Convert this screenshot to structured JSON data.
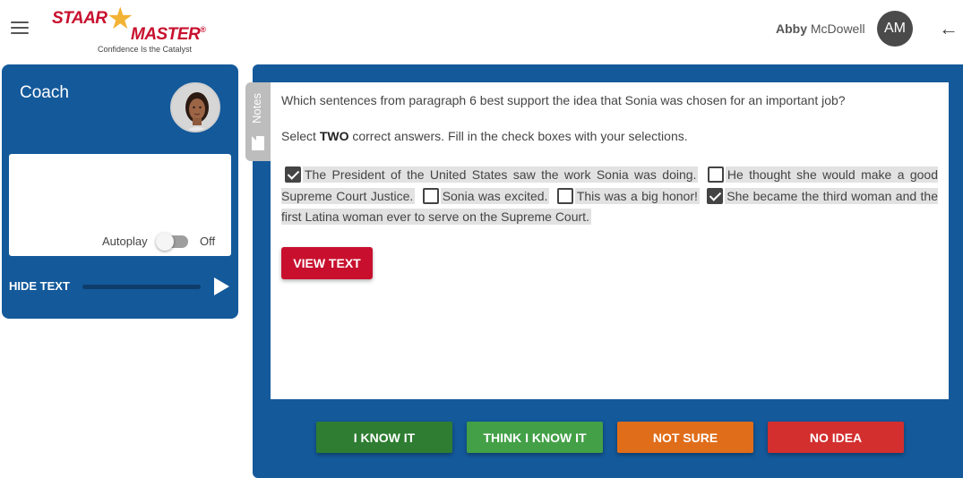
{
  "header": {
    "logo_word1": "STAAR",
    "logo_word2": "MASTER",
    "logo_reg": "®",
    "logo_tagline": "Confidence Is the Catalyst",
    "user_first": "Abby",
    "user_last": "McDowell",
    "avatar_initials": "AM",
    "menu_icon": "hamburger-menu-icon",
    "back_icon": "arrow-left-icon"
  },
  "coach": {
    "title": "Coach",
    "autoplay_label": "Autoplay",
    "autoplay_state": "Off",
    "hide_text_label": "HIDE TEXT",
    "audio_progress": 0,
    "play_icon": "play-icon"
  },
  "notes": {
    "label": "Notes",
    "icon": "note-icon"
  },
  "question": {
    "prompt": "Which sentences from paragraph 6 best support the idea that Sonia was chosen for an important job?",
    "instruction_pre": "Select ",
    "instruction_bold": "TWO",
    "instruction_post": " correct answers. Fill in the check boxes with your selections.",
    "sentences": [
      {
        "text": "The President of the United States saw the work Sonia was doing.",
        "checked": true
      },
      {
        "text": "He thought she would make a good Supreme Court Justice.",
        "checked": false
      },
      {
        "text": "Sonia was excited.",
        "checked": false
      },
      {
        "text": "This was a big honor!",
        "checked": false
      },
      {
        "text": "She became the third woman and the first Latina woman ever to serve on the Supreme Court.",
        "checked": true
      }
    ],
    "view_text_label": "VIEW TEXT"
  },
  "confidence": {
    "know": "I KNOW IT",
    "think": "THINK I KNOW IT",
    "not_sure": "NOT SURE",
    "no_idea": "NO IDEA"
  },
  "colors": {
    "panel_blue": "#14599a",
    "brand_red": "#c8102e",
    "know_green": "#2e7d32",
    "think_green": "#43a047",
    "not_sure_orange": "#e06d1a",
    "no_idea_red": "#d32f2f"
  }
}
